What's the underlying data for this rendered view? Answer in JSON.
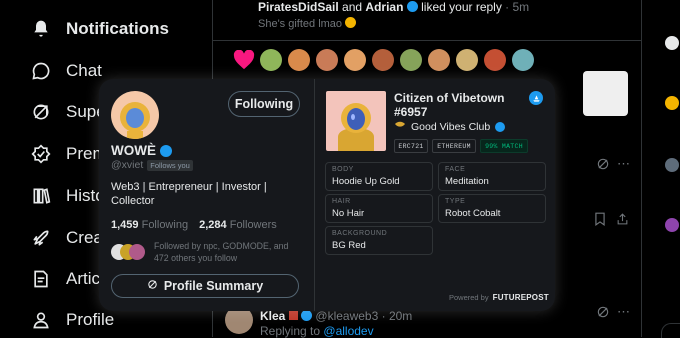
{
  "sidebar": {
    "items": [
      {
        "label": "Notifications",
        "icon": "bell-icon",
        "active": true
      },
      {
        "label": "Chat",
        "icon": "chat-icon"
      },
      {
        "label": "Super",
        "icon": "super-icon"
      },
      {
        "label": "Premi",
        "icon": "premium-icon"
      },
      {
        "label": "Histo",
        "icon": "history-icon"
      },
      {
        "label": "Creat",
        "icon": "rocket-icon"
      },
      {
        "label": "Articl",
        "icon": "articles-icon"
      },
      {
        "label": "Profile",
        "icon": "profile-icon"
      }
    ]
  },
  "feed": {
    "like_notification": {
      "names_a": "PiratesDidSail",
      "and": "and",
      "names_b": "Adrian",
      "action": "liked your reply",
      "time": "· 5m",
      "preview": "She's gifted lmao"
    },
    "reply": {
      "name": "Klea",
      "handle": "@kleaweb3",
      "time": "· 20m",
      "replying_prefix": "Replying to",
      "replying_handle": "@allodev"
    }
  },
  "hover_card": {
    "follow_button": "Following",
    "display_name": "WOWÈ",
    "handle": "@xviet",
    "follows_you": "Follows you",
    "bio": "Web3 | Entrepreneur | Investor | Collector",
    "following_count": "1,459",
    "following_label": "Following",
    "followers_count": "2,284",
    "followers_label": "Followers",
    "followed_by": "Followed by npc, GODMODE, and 472 others you follow",
    "summary_button": "Profile Summary"
  },
  "nft": {
    "title": "Citizen of Vibetown #6957",
    "collection": "Good Vibes Club",
    "tags": [
      "ERC721",
      "ETHEREUM",
      "99% MATCH"
    ],
    "attributes": [
      {
        "key": "BODY",
        "value": "Hoodie Up Gold"
      },
      {
        "key": "FACE",
        "value": "Meditation"
      },
      {
        "key": "HAIR",
        "value": "No Hair"
      },
      {
        "key": "TYPE",
        "value": "Robot Cobalt"
      },
      {
        "key": "BACKGROUND",
        "value": "BG Red"
      }
    ],
    "powered_by": "Powered by",
    "brand": "FUTUREPOST"
  },
  "colors": {
    "accent": "#1d9bf0",
    "match_green": "#00ba7c",
    "heart": "#f91880"
  }
}
